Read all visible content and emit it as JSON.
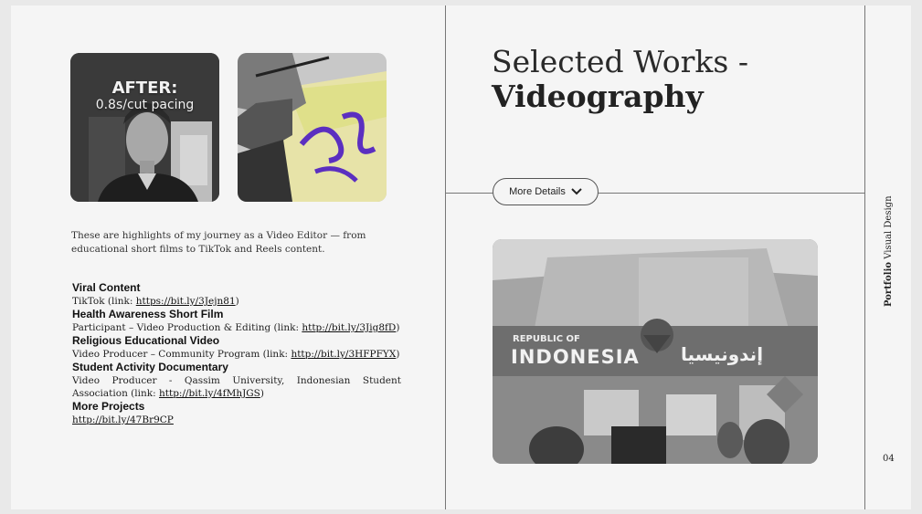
{
  "thumbnails": {
    "first": {
      "title": "AFTER:",
      "subtitle": "0.8s/cut pacing"
    }
  },
  "intro": "These are highlights of my journey as a Video Editor — from educational short films to TikTok and Reels content.",
  "projects": [
    {
      "title": "Viral Content",
      "desc": "TikTok (link: ",
      "link": "https://bit.ly/3Jejn81",
      "end": ")"
    },
    {
      "title": "Health Awareness Short Film",
      "desc": "Participant – Video Production & Editing (link: ",
      "link": "http://bit.ly/3Jig8fD",
      "end": ")"
    },
    {
      "title": "Religious Educational Video",
      "desc": "Video Producer – Community Program (link: ",
      "link": "http://bit.ly/3HFPFYX",
      "end": ")"
    },
    {
      "title": "Student Activity Documentary",
      "desc": "Video Producer - Qassim University, Indonesian Student Association (link: ",
      "link": "http://bit.ly/4fMhJGS",
      "end": ")"
    },
    {
      "title": "More Projects",
      "desc": "",
      "link": "http://bit.ly/47Br9CP",
      "end": ""
    }
  ],
  "heading": {
    "line1": "Selected Works -",
    "line2": "Videography"
  },
  "more_button": {
    "label": "More Details",
    "icon": "chevron-down-icon"
  },
  "photo_sign": {
    "left": "REPUBLIC OF",
    "main": "INDONESIA",
    "arabic": "إندونيسيا"
  },
  "side": {
    "bold": "Portfolio",
    "rest": " Visual Design"
  },
  "page_number": "04"
}
